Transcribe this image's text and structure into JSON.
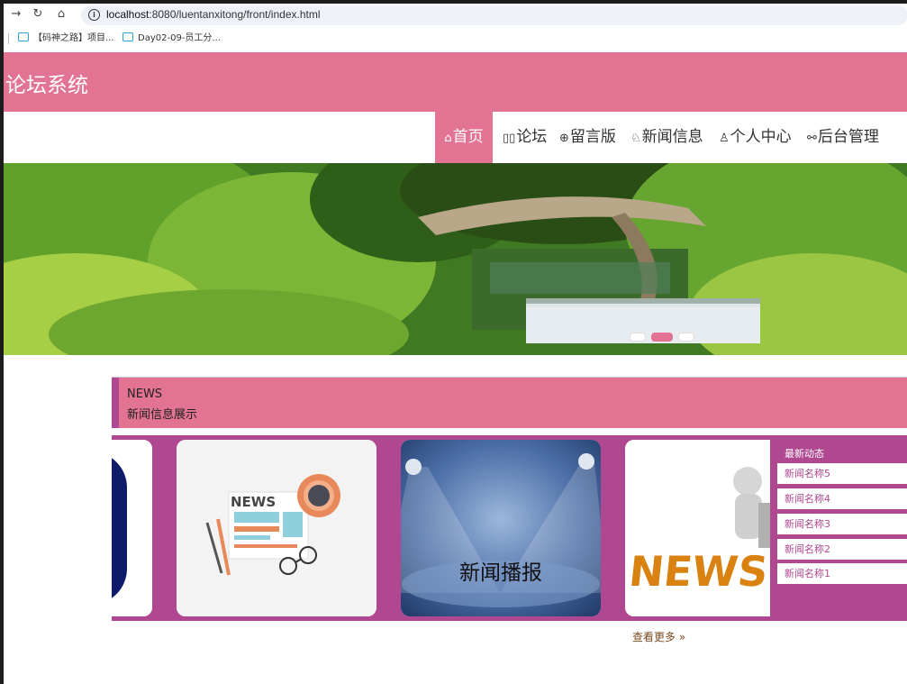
{
  "browser": {
    "url_host": "localhost",
    "url_rest": ":8080/luentanxitong/front/index.html",
    "bookmarks": [
      {
        "label": "【码神之路】项目..."
      },
      {
        "label": "Day02-09-员工分..."
      }
    ]
  },
  "site": {
    "title": "论坛系统"
  },
  "nav": {
    "items": [
      {
        "label": "首页",
        "icon": "home-icon",
        "active": true
      },
      {
        "label": "论坛",
        "icon": "forum-icon"
      },
      {
        "label": "留言版",
        "icon": "globe-icon"
      },
      {
        "label": "新闻信息",
        "icon": "book-icon"
      },
      {
        "label": "个人中心",
        "icon": "user-icon"
      },
      {
        "label": "后台管理",
        "icon": "link-icon"
      }
    ]
  },
  "banner": {
    "slide_count": 3,
    "active_slide": 2
  },
  "news": {
    "heading_en": "NEWS",
    "heading_cn": "新闻信息展示",
    "cards": [
      {
        "label": ""
      },
      {
        "label": ""
      },
      {
        "label": "新闻播报"
      },
      {
        "label": ""
      }
    ],
    "latest": {
      "title": "最新动态",
      "items": [
        "新闻名称5",
        "新闻名称4",
        "新闻名称3",
        "新闻名称2",
        "新闻名称1"
      ]
    },
    "more_label": "查看更多"
  },
  "colors": {
    "accent": "#e27393",
    "purple": "#b04891"
  }
}
